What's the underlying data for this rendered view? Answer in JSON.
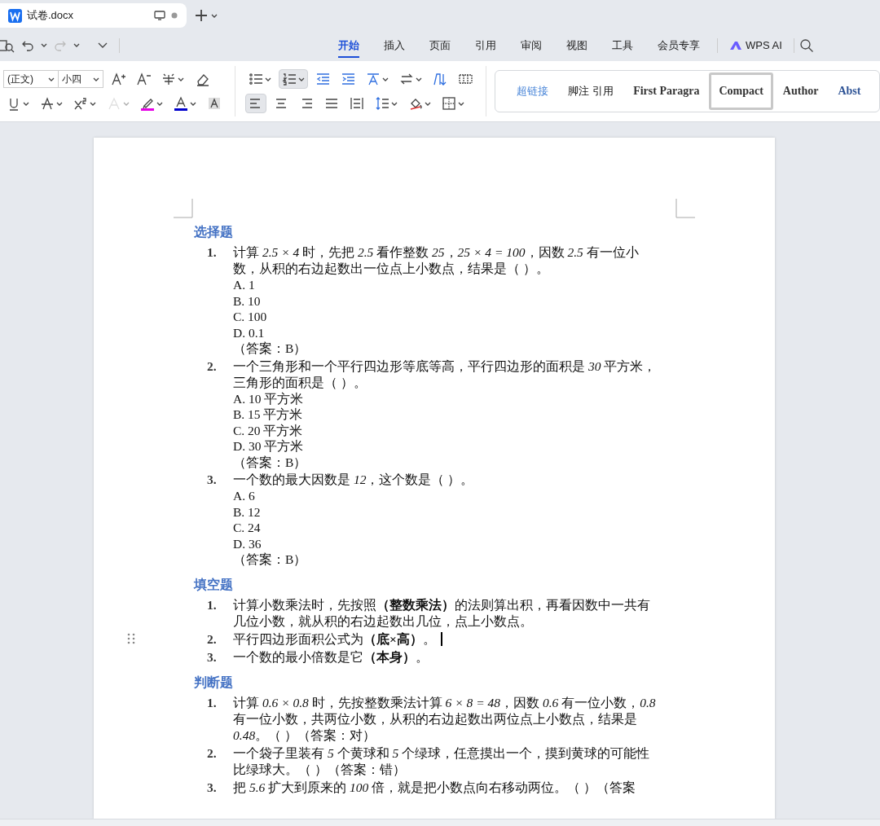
{
  "tab": {
    "title": "试卷.docx"
  },
  "menu": [
    {
      "label": "开始",
      "selected": true
    },
    {
      "label": "插入",
      "selected": false
    },
    {
      "label": "页面",
      "selected": false
    },
    {
      "label": "引用",
      "selected": false
    },
    {
      "label": "审阅",
      "selected": false
    },
    {
      "label": "视图",
      "selected": false
    },
    {
      "label": "工具",
      "selected": false
    },
    {
      "label": "会员专享",
      "selected": false
    }
  ],
  "ai_button": {
    "label": "WPS AI"
  },
  "font": {
    "name": "(正文)",
    "size": "小四"
  },
  "font_tools": [
    [
      {
        "kind": "grow",
        "dropdown": false,
        "pressed": false,
        "disabled": false
      },
      {
        "kind": "shrink",
        "dropdown": false,
        "pressed": false,
        "disabled": false
      },
      {
        "kind": "phonetic",
        "dropdown": true,
        "pressed": false,
        "disabled": false
      },
      {
        "kind": "eraser",
        "dropdown": false,
        "pressed": false,
        "disabled": false
      }
    ],
    [
      {
        "kind": "underline",
        "dropdown": true,
        "pressed": false,
        "disabled": false
      },
      {
        "kind": "strike",
        "dropdown": true,
        "pressed": false,
        "disabled": false
      },
      {
        "kind": "superscript",
        "dropdown": true,
        "pressed": false,
        "disabled": false
      },
      {
        "kind": "effect",
        "dropdown": true,
        "pressed": false,
        "disabled": true
      },
      {
        "kind": "highlight",
        "dropdown": true,
        "pressed": false,
        "disabled": false
      },
      {
        "kind": "fontcolor",
        "dropdown": true,
        "pressed": false,
        "disabled": false
      },
      {
        "kind": "shading",
        "dropdown": false,
        "pressed": false,
        "disabled": false
      }
    ]
  ],
  "para_tools": [
    [
      {
        "kind": "bullets",
        "dropdown": true,
        "pressed": false,
        "disabled": false
      },
      {
        "kind": "numbering",
        "dropdown": true,
        "pressed": true,
        "disabled": false
      },
      {
        "kind": "outdent",
        "dropdown": false,
        "pressed": false,
        "disabled": false
      },
      {
        "kind": "indent",
        "dropdown": false,
        "pressed": false,
        "disabled": false
      },
      {
        "kind": "spacing",
        "dropdown": true,
        "pressed": false,
        "disabled": false
      },
      {
        "kind": "swap",
        "dropdown": true,
        "pressed": false,
        "disabled": false
      },
      {
        "kind": "sort",
        "dropdown": false,
        "pressed": false,
        "disabled": false
      },
      {
        "kind": "grid",
        "dropdown": false,
        "pressed": false,
        "disabled": false
      }
    ],
    [
      {
        "kind": "left",
        "dropdown": false,
        "pressed": true,
        "disabled": false
      },
      {
        "kind": "center",
        "dropdown": false,
        "pressed": false,
        "disabled": false
      },
      {
        "kind": "right",
        "dropdown": false,
        "pressed": false,
        "disabled": false
      },
      {
        "kind": "justify",
        "dropdown": false,
        "pressed": false,
        "disabled": false
      },
      {
        "kind": "distribute",
        "dropdown": false,
        "pressed": false,
        "disabled": false
      },
      {
        "kind": "linespacing",
        "dropdown": true,
        "pressed": false,
        "disabled": false
      },
      {
        "kind": "fill",
        "dropdown": true,
        "pressed": false,
        "disabled": false
      },
      {
        "kind": "border",
        "dropdown": true,
        "pressed": false,
        "disabled": false
      }
    ]
  ],
  "styles": [
    {
      "label": "超链接",
      "kind": "link",
      "selected": false
    },
    {
      "label": "脚注 引用",
      "kind": "plain",
      "selected": false
    },
    {
      "label": "First Paragra",
      "kind": "serif",
      "selected": false
    },
    {
      "label": "Compact",
      "kind": "serif",
      "selected": true
    },
    {
      "label": "Author",
      "kind": "serif",
      "selected": false
    },
    {
      "label": "Abst",
      "kind": "heading",
      "selected": false
    }
  ],
  "document": {
    "sections": [
      {
        "heading": "选择题",
        "items": [
          {
            "number": "1.",
            "text": "计算 *2.5 × 4* 时，先把 *2.5* 看作整数 *25*，*25 × 4 = 100*，因数 *2.5* 有一位小数，从积的右边起数出一位点上小数点，结果是（ ）。",
            "options": [
              "A. 1",
              "B. 10",
              "C. 100",
              "D. 0.1"
            ],
            "answer": "（答案：B）",
            "cursor": false
          },
          {
            "number": "2.",
            "text": "一个三角形和一个平行四边形等底等高，平行四边形的面积是 *30* 平方米，三角形的面积是（ ）。",
            "options": [
              "A. 10 平方米",
              "B. 15 平方米",
              "C. 20 平方米",
              "D. 30 平方米"
            ],
            "answer": "（答案：B）",
            "cursor": false
          },
          {
            "number": "3.",
            "text": "一个数的最大因数是 *12*，这个数是（ ）。",
            "options": [
              "A. 6",
              "B. 12",
              "C. 24",
              "D. 36"
            ],
            "answer": "（答案：B）",
            "cursor": false
          }
        ]
      },
      {
        "heading": "填空题",
        "items": [
          {
            "number": "1.",
            "text": "计算小数乘法时，先按照**（整数乘法）**的法则算出积，再看因数中一共有几位小数，就从积的右边起数出几位，点上小数点。",
            "cursor": false
          },
          {
            "number": "2.",
            "text": "平行四边形面积公式为**（底×高）**。",
            "cursor": true
          },
          {
            "number": "3.",
            "text": "一个数的最小倍数是它**（本身）**。",
            "cursor": false
          }
        ]
      },
      {
        "heading": "判断题",
        "items": [
          {
            "number": "1.",
            "text": "计算 *0.6 × 0.8* 时，先按整数乘法计算 *6 × 8 = 48*，因数 *0.6* 有一位小数，*0.8* 有一位小数，共两位小数，从积的右边起数出两位点上小数点，结果是 *0.48*。（ ）（答案：对）",
            "cursor": false
          },
          {
            "number": "2.",
            "text": "一个袋子里装有 *5* 个黄球和 *5* 个绿球，任意摸出一个，摸到黄球的可能性比绿球大。（ ）（答案：错）",
            "cursor": false
          },
          {
            "number": "3.",
            "text": "把 *5.6* 扩大到原来的 *100* 倍，就是把小数点向右移动两位。（ ）（答案",
            "cursor": false
          }
        ]
      }
    ]
  }
}
